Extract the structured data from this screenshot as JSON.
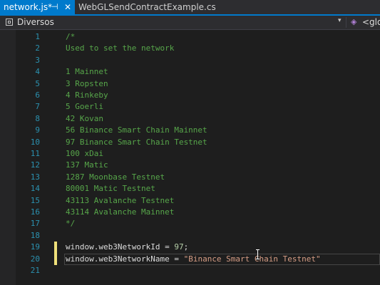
{
  "tabs": [
    {
      "label": "network.js*",
      "pin_glyph": "⊣",
      "close_glyph": "✕",
      "active": true
    },
    {
      "label": "WebGLSendContractExample.cs",
      "active": false
    }
  ],
  "navbar": {
    "scope": "Diversos",
    "chevron_glyph": "▾",
    "member_glyph": "◈",
    "member": "<glo"
  },
  "code_lines": [
    {
      "num": "1",
      "text": "/*",
      "kind": "comment"
    },
    {
      "num": "2",
      "text": "Used to set the network",
      "kind": "comment"
    },
    {
      "num": "3",
      "text": "",
      "kind": "comment"
    },
    {
      "num": "4",
      "text": "1 Mainnet",
      "kind": "comment"
    },
    {
      "num": "5",
      "text": "3 Ropsten",
      "kind": "comment"
    },
    {
      "num": "6",
      "text": "4 Rinkeby",
      "kind": "comment"
    },
    {
      "num": "7",
      "text": "5 Goerli",
      "kind": "comment"
    },
    {
      "num": "8",
      "text": "42 Kovan",
      "kind": "comment"
    },
    {
      "num": "9",
      "text": "56 Binance Smart Chain Mainnet",
      "kind": "comment"
    },
    {
      "num": "10",
      "text": "97 Binance Smart Chain Testnet",
      "kind": "comment"
    },
    {
      "num": "11",
      "text": "100 xDai",
      "kind": "comment"
    },
    {
      "num": "12",
      "text": "137 Matic",
      "kind": "comment"
    },
    {
      "num": "13",
      "text": "1287 Moonbase Testnet",
      "kind": "comment"
    },
    {
      "num": "14",
      "text": "80001 Matic Testnet",
      "kind": "comment"
    },
    {
      "num": "15",
      "text": "43113 Avalanche Testnet",
      "kind": "comment"
    },
    {
      "num": "16",
      "text": "43114 Avalanche Mainnet",
      "kind": "comment"
    },
    {
      "num": "17",
      "text": "*/",
      "kind": "comment"
    },
    {
      "num": "18",
      "text": "",
      "kind": "plain"
    },
    {
      "num": "19",
      "kind": "code",
      "changed": true,
      "tokens": [
        {
          "t": "window.web3NetworkId = ",
          "c": "plain"
        },
        {
          "t": "97",
          "c": "num"
        },
        {
          "t": ";",
          "c": "plain"
        }
      ]
    },
    {
      "num": "20",
      "kind": "code",
      "changed": true,
      "current": true,
      "tokens": [
        {
          "t": "window.web3NetworkName = ",
          "c": "plain"
        },
        {
          "t": "\"Binance Smart Chain Testnet\"",
          "c": "str"
        }
      ]
    },
    {
      "num": "21",
      "text": "",
      "kind": "plain"
    }
  ],
  "colors": {
    "accent": "#007acc",
    "comment": "#57a64a",
    "line_number": "#2b91af",
    "string": "#d69d85",
    "number": "#b5cea8",
    "change_marker": "#efe07a"
  }
}
